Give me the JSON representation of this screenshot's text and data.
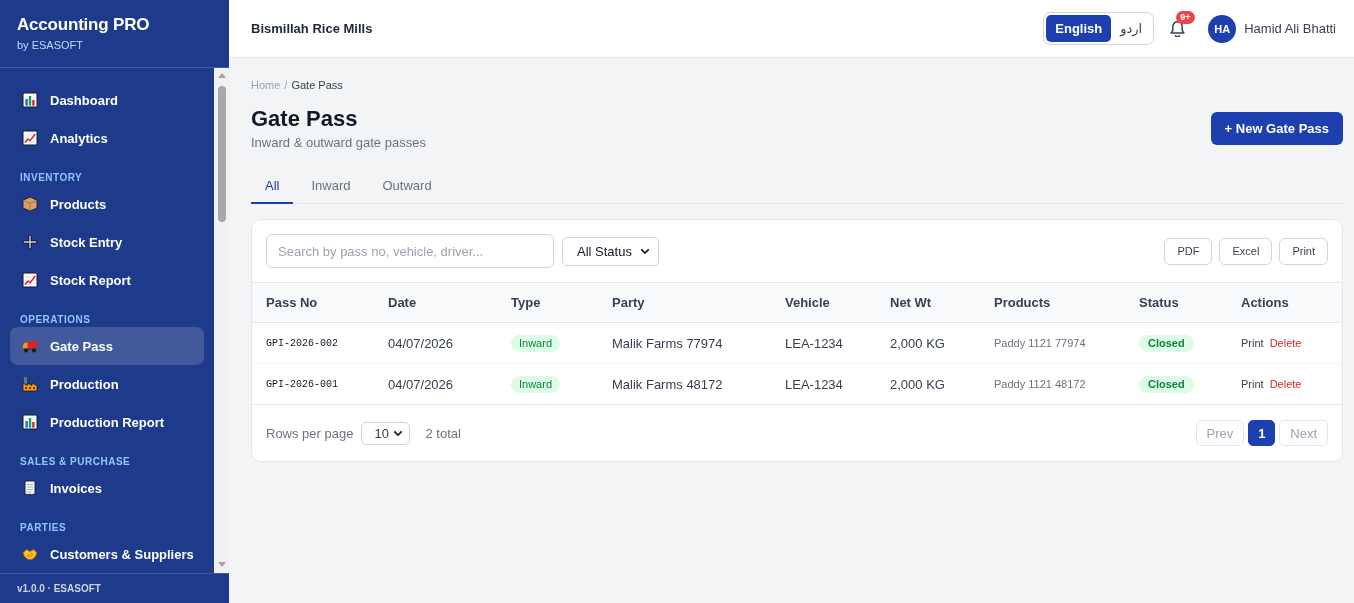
{
  "sidebar": {
    "brand": {
      "title": "Accounting PRO",
      "subtitle": "by ESASOFT"
    },
    "sections": [
      {
        "items": [
          {
            "label": "Dashboard",
            "selected": false
          },
          {
            "label": "Analytics",
            "selected": false
          }
        ]
      },
      {
        "heading": "INVENTORY",
        "items": [
          {
            "label": "Products",
            "selected": false
          },
          {
            "label": "Stock Entry",
            "selected": false
          },
          {
            "label": "Stock Report",
            "selected": false
          }
        ]
      },
      {
        "heading": "OPERATIONS",
        "items": [
          {
            "label": "Gate Pass",
            "selected": true
          },
          {
            "label": "Production",
            "selected": false
          },
          {
            "label": "Production Report",
            "selected": false
          }
        ]
      },
      {
        "heading": "SALES & PURCHASE",
        "items": [
          {
            "label": "Invoices",
            "selected": false
          }
        ]
      },
      {
        "heading": "PARTIES",
        "items": [
          {
            "label": "Customers & Suppliers",
            "selected": false
          }
        ]
      }
    ],
    "footer": "v1.0.0 · ESASOFT"
  },
  "header": {
    "company": "Bismillah Rice Mills",
    "languages": [
      {
        "label": "English",
        "selected": true
      },
      {
        "label": "اردو",
        "selected": false
      }
    ],
    "notifications": {
      "badge": "9+"
    },
    "user": {
      "initials": "HA",
      "name": "Hamid Ali Bhatti"
    }
  },
  "breadcrumb": {
    "items": [
      "Home",
      "Gate Pass"
    ],
    "separator": "/"
  },
  "page": {
    "title": "Gate Pass",
    "subtitle": "Inward & outward gate passes",
    "primary_action": "+ New Gate Pass"
  },
  "tabs": [
    {
      "label": "All",
      "selected": true
    },
    {
      "label": "Inward",
      "selected": false
    },
    {
      "label": "Outward",
      "selected": false
    }
  ],
  "toolbar": {
    "search": {
      "placeholder": "Search by pass no, vehicle, driver..."
    },
    "status_filter": {
      "value": "All Status"
    },
    "exports": [
      "PDF",
      "Excel",
      "Print"
    ]
  },
  "table": {
    "columns": [
      "Pass No",
      "Date",
      "Type",
      "Party",
      "Vehicle",
      "Net Wt",
      "Products",
      "Status",
      "Actions"
    ],
    "rows": [
      {
        "pass_no": "GPI-2026-002",
        "date": "04/07/2026",
        "type": "Inward",
        "party": "Malik Farms 77974",
        "vehicle": "LEA-1234",
        "net_wt": "2,000 KG",
        "products": "Paddy 1121 77974",
        "status": "Closed",
        "actions": [
          {
            "label": "Print",
            "kind": "print"
          },
          {
            "label": "Delete",
            "kind": "delete"
          }
        ]
      },
      {
        "pass_no": "GPI-2026-001",
        "date": "04/07/2026",
        "type": "Inward",
        "party": "Malik Farms 48172",
        "vehicle": "LEA-1234",
        "net_wt": "2,000 KG",
        "products": "Paddy 1121 48172",
        "status": "Closed",
        "actions": [
          {
            "label": "Print",
            "kind": "print"
          },
          {
            "label": "Delete",
            "kind": "delete"
          }
        ]
      }
    ]
  },
  "pagination": {
    "rows_per_page_label": "Rows per page",
    "rows_per_page": "10",
    "total": "2 total",
    "prev": {
      "label": "Prev",
      "disabled": true
    },
    "pages": [
      {
        "label": "1",
        "selected": true
      }
    ],
    "next": {
      "label": "Next",
      "disabled": true
    }
  }
}
